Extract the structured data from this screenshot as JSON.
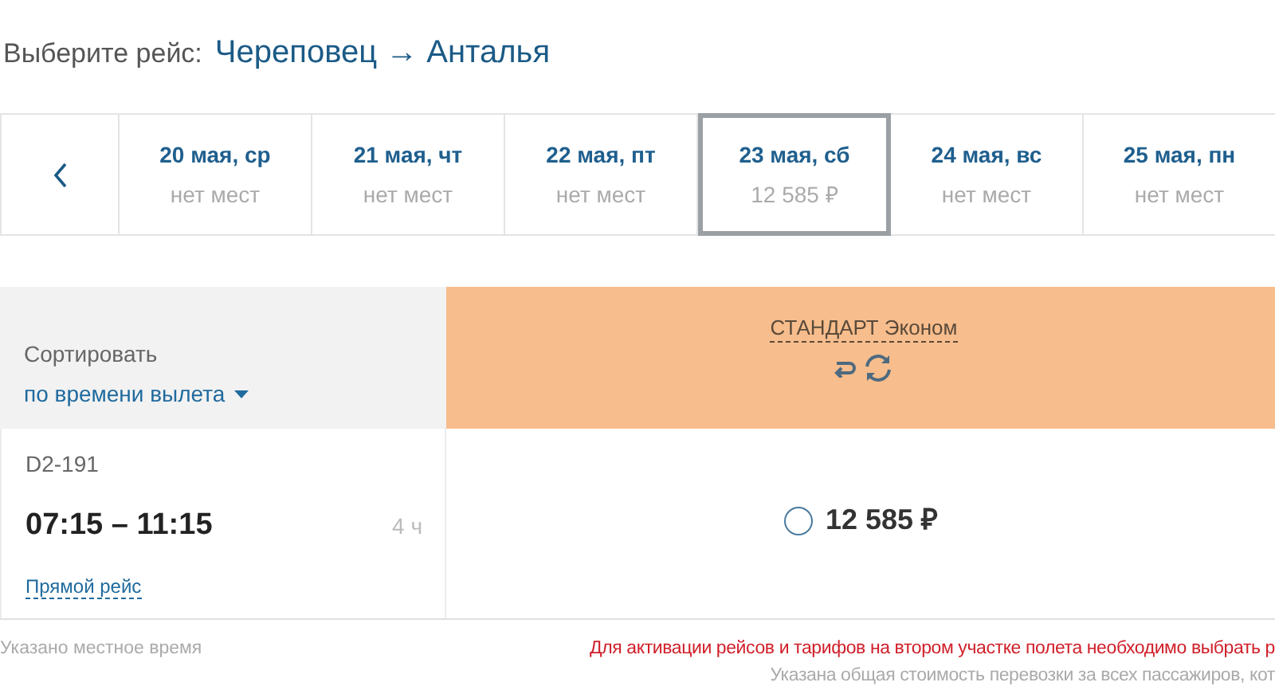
{
  "heading": {
    "label": "Выберите рейс:",
    "route": "Череповец → Анталья"
  },
  "dates": [
    {
      "date": "20 мая, ср",
      "info": "нет мест",
      "selected": false
    },
    {
      "date": "21 мая, чт",
      "info": "нет мест",
      "selected": false
    },
    {
      "date": "22 мая, пт",
      "info": "нет мест",
      "selected": false
    },
    {
      "date": "23 мая, сб",
      "info": "12 585 ₽",
      "selected": true
    },
    {
      "date": "24 мая, вс",
      "info": "нет мест",
      "selected": false
    },
    {
      "date": "25 мая, пн",
      "info": "нет мест",
      "selected": false
    }
  ],
  "sort": {
    "label": "Сортировать",
    "value": "по времени вылета"
  },
  "fare_header": {
    "name": "СТАНДАРТ Эконом"
  },
  "flight": {
    "number": "D2-191",
    "times": "07:15 – 11:15",
    "duration": "4 ч",
    "type": "Прямой рейс",
    "fare": {
      "price": "12 585 ₽",
      "selected": false
    }
  },
  "footer": {
    "local_time": "Указано местное время",
    "warning": "Для активации рейсов и тарифов на втором участке полета необходимо выбрать р",
    "total_note": "Указана общая стоимость перевозки за всех пассажиров, кот"
  }
}
